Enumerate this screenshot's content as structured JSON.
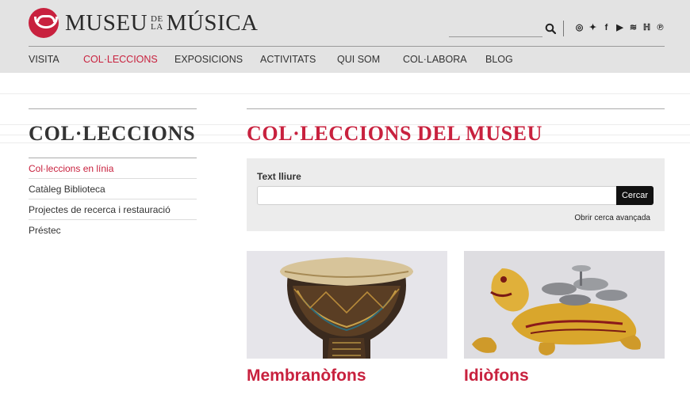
{
  "brand": {
    "name_left": "MUSEU",
    "name_small_top": "DE",
    "name_small_bottom": "LA",
    "name_right": "MÚSICA",
    "color": "#c8213e"
  },
  "header": {
    "search_placeholder": "",
    "socials": [
      {
        "icon": "instagram-icon",
        "glyph": "◎"
      },
      {
        "icon": "twitter-icon",
        "glyph": "✦"
      },
      {
        "icon": "facebook-icon",
        "glyph": "f"
      },
      {
        "icon": "youtube-icon",
        "glyph": "▶"
      },
      {
        "icon": "spotify-icon",
        "glyph": "≋"
      },
      {
        "icon": "houzz-icon",
        "glyph": "ℍ"
      },
      {
        "icon": "pinterest-icon",
        "glyph": "℗"
      }
    ]
  },
  "nav": {
    "items": [
      {
        "label": "VISITA",
        "active": false
      },
      {
        "label": "COL·LECCIONS",
        "active": true
      },
      {
        "label": "EXPOSICIONS",
        "active": false
      },
      {
        "label": "ACTIVITATS",
        "active": false
      },
      {
        "label": "QUI SOM",
        "active": false
      },
      {
        "label": "COL·LABORA",
        "active": false
      },
      {
        "label": "BLOG",
        "active": false
      }
    ]
  },
  "sidebar": {
    "title": "COL·LECCIONS",
    "items": [
      {
        "label": "Col·leccions en línia",
        "active": true
      },
      {
        "label": "Catàleg Biblioteca",
        "active": false
      },
      {
        "label": "Projectes de recerca i restauració",
        "active": false
      },
      {
        "label": "Préstec",
        "active": false
      }
    ]
  },
  "main": {
    "title": "COL·LECCIONS DEL MUSEU",
    "search": {
      "label": "Text lliure",
      "value": "",
      "button": "Cercar",
      "advanced_link": "Obrir cerca avançada"
    },
    "cards": [
      {
        "title": "Membranòfons"
      },
      {
        "title": "Idiòfons"
      }
    ]
  }
}
